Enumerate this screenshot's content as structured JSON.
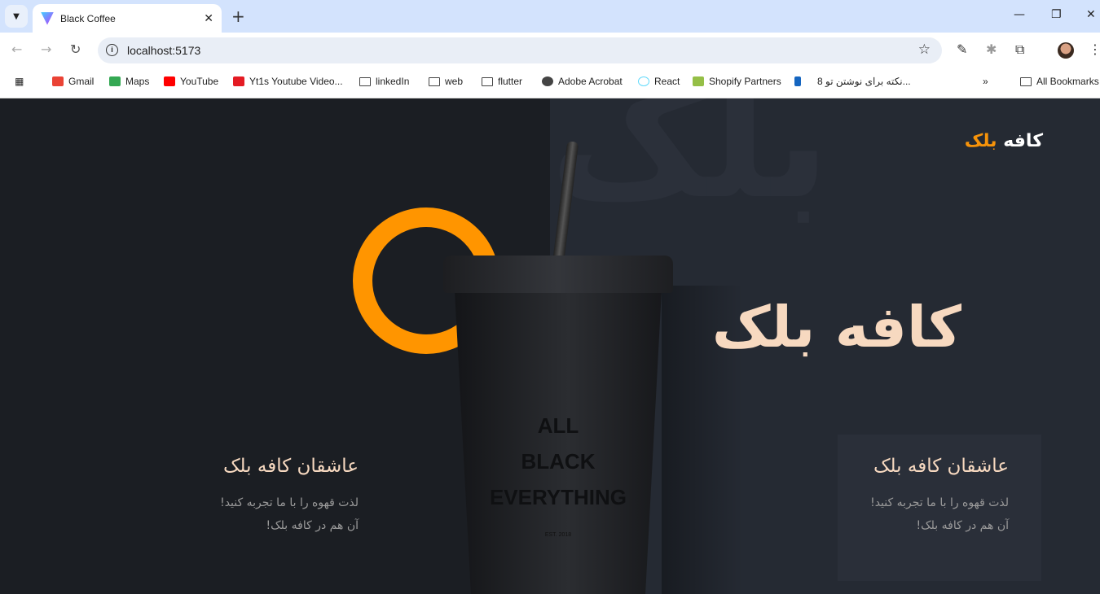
{
  "browser": {
    "tab_title": "Black Coffee",
    "url": "localhost:5173",
    "bookmarks": [
      "Gmail",
      "Maps",
      "YouTube",
      "Yt1s Youtube Video...",
      "linkedIn",
      "web",
      "flutter",
      "Adobe Acrobat",
      "React",
      "Shopify Partners",
      "8 نکته برای نوشتن تو..."
    ],
    "all_bookmarks": "All Bookmarks"
  },
  "site": {
    "brand_main": "کافه",
    "brand_accent": "بلک",
    "hero_title": "کافه بلک",
    "watermark": "بلک",
    "cup_text": [
      "ALL",
      "BLACK",
      "EVERYTHING"
    ],
    "cup_est": "EST. 2018",
    "cards": [
      {
        "title": "عاشقان کافه بلک",
        "line1": "لذت قهوه را با ما تجربه کنید!",
        "line2": "آن هم در کافه بلک!"
      },
      {
        "title": "عاشقان کافه بلک",
        "line1": "لذت قهوه را با ما تجربه کنید!",
        "line2": "آن هم در کافه بلک!"
      }
    ]
  },
  "colors": {
    "accent": "#ff9500",
    "hero_text": "#f7d9c0",
    "bg_left": "#1b1e23",
    "bg_right": "#252a33"
  }
}
